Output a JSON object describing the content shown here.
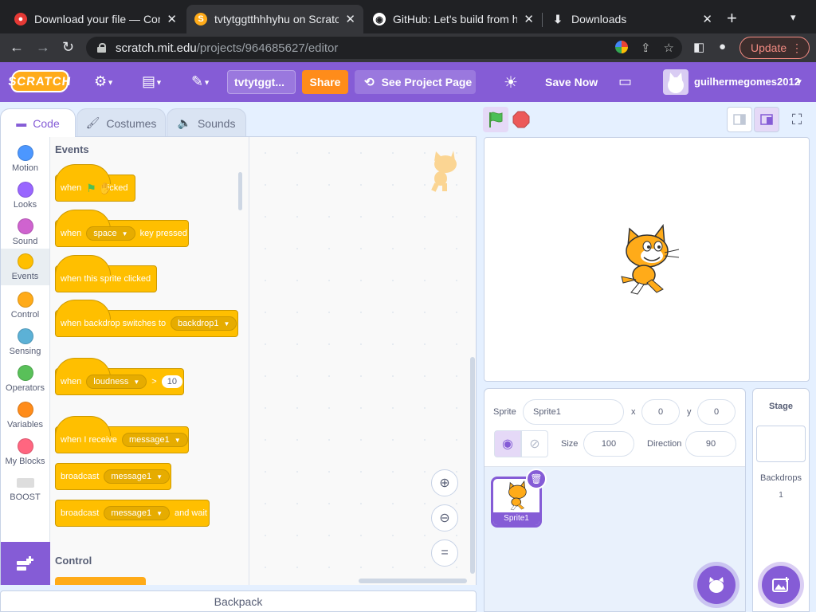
{
  "browser": {
    "tabs": [
      {
        "title": "Download your file — Conve",
        "favicon": "red-circle-icon"
      },
      {
        "title": "tvtytggtthhhyhu on Scratch",
        "favicon": "scratch-cat-icon"
      },
      {
        "title": "GitHub: Let's build from her",
        "favicon": "github-icon"
      },
      {
        "title": "Downloads",
        "favicon": "download-icon"
      }
    ],
    "url_host": "scratch.mit.edu",
    "url_path": "/projects/964685627/editor",
    "update_label": "Update"
  },
  "menubar": {
    "logo": "SCRATCH",
    "project_title": "tvtytggt...",
    "share": "Share",
    "see_project_page": "See Project Page",
    "save_now": "Save Now",
    "username": "guilhermegomes2012",
    "accent": "#855cd6"
  },
  "editor_tabs": {
    "code": "Code",
    "costumes": "Costumes",
    "sounds": "Sounds"
  },
  "categories": [
    {
      "label": "Motion",
      "color": "#4c97ff"
    },
    {
      "label": "Looks",
      "color": "#9966ff"
    },
    {
      "label": "Sound",
      "color": "#cf63cf"
    },
    {
      "label": "Events",
      "color": "#ffbf00"
    },
    {
      "label": "Control",
      "color": "#ffab19"
    },
    {
      "label": "Sensing",
      "color": "#5cb1d6"
    },
    {
      "label": "Operators",
      "color": "#59c059"
    },
    {
      "label": "Variables",
      "color": "#ff8c1a"
    },
    {
      "label": "My Blocks",
      "color": "#ff6680"
    },
    {
      "label": "BOOST",
      "color": "#dddddd"
    }
  ],
  "palette": {
    "events_label": "Events",
    "control_label": "Control",
    "blocks": {
      "flag_clicked": {
        "when": "when",
        "clicked": "clicked"
      },
      "key_pressed": {
        "when": "when",
        "key": "space",
        "rest": "key pressed"
      },
      "sprite_clicked": {
        "text": "when this sprite clicked"
      },
      "backdrop_switches": {
        "text": "when backdrop switches to",
        "backdrop": "backdrop1"
      },
      "loudness": {
        "when": "when",
        "menu": "loudness",
        "op": ">",
        "value": "10"
      },
      "receive": {
        "text": "when I receive",
        "message": "message1"
      },
      "broadcast": {
        "text": "broadcast",
        "message": "message1"
      },
      "broadcast_wait": {
        "text": "broadcast",
        "message": "message1",
        "rest": "and wait"
      }
    }
  },
  "sprite_info": {
    "sprite_label": "Sprite",
    "sprite_name": "Sprite1",
    "x_label": "x",
    "x": "0",
    "y_label": "y",
    "y": "0",
    "size_label": "Size",
    "size": "100",
    "direction_label": "Direction",
    "direction": "90"
  },
  "sprite_list": [
    {
      "name": "Sprite1"
    }
  ],
  "stage_panel": {
    "title": "Stage",
    "backdrops_label": "Backdrops",
    "backdrops_count": "1"
  },
  "backpack": "Backpack"
}
